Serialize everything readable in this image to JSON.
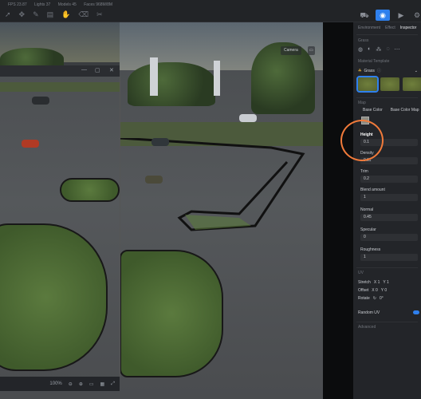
{
  "stats": {
    "fps": "FPS 23.87",
    "lights": "Lights 37",
    "models": "Models 45",
    "faces": "Faces 968M/8M"
  },
  "toolbar_icons": [
    "cursor-icon",
    "move-icon",
    "brush-icon",
    "scene-icon",
    "hand-icon",
    "eraser-icon",
    "cut-icon"
  ],
  "viewport": {
    "camera_btn": "Camera",
    "display_btn": "Display",
    "zoom": "100%",
    "window_controls": [
      "—",
      "▢",
      "✕"
    ]
  },
  "panel": {
    "tabs": [
      "Environment",
      "Effect",
      "Inspector",
      "Li"
    ],
    "active_tab": "Inspector",
    "section_grass": "Grass",
    "material_template": "Material Template",
    "material_selected": "Grass",
    "map_label": "Map",
    "base_color": "Base Color",
    "base_color_map": "Base Color Map",
    "height_label": "Height",
    "height_value": "0.1",
    "density_label": "Density",
    "density_value": "0.11",
    "trim_label": "Trim",
    "trim_value": "0.2",
    "blend_label": "Blend amount",
    "blend_value": "1",
    "normal_label": "Normal",
    "normal_value": "0.45",
    "specular_label": "Specular",
    "specular_value": "0",
    "roughness_label": "Roughness",
    "roughness_value": "1",
    "uv_label": "UV",
    "stretch_label": "Stretch",
    "stretch_x": "X 1",
    "stretch_y": "Y 1",
    "offset_label": "Offset",
    "offset_x": "X 0",
    "offset_y": "Y 0",
    "rotate_label": "Rotate",
    "rotate_value": "0°",
    "random_uv_label": "Random UV",
    "advanced_label": "Advanced",
    "swatch_color": "#8d8c82",
    "accent_color": "#2f80ed",
    "highlight_color": "#f07a3a"
  }
}
